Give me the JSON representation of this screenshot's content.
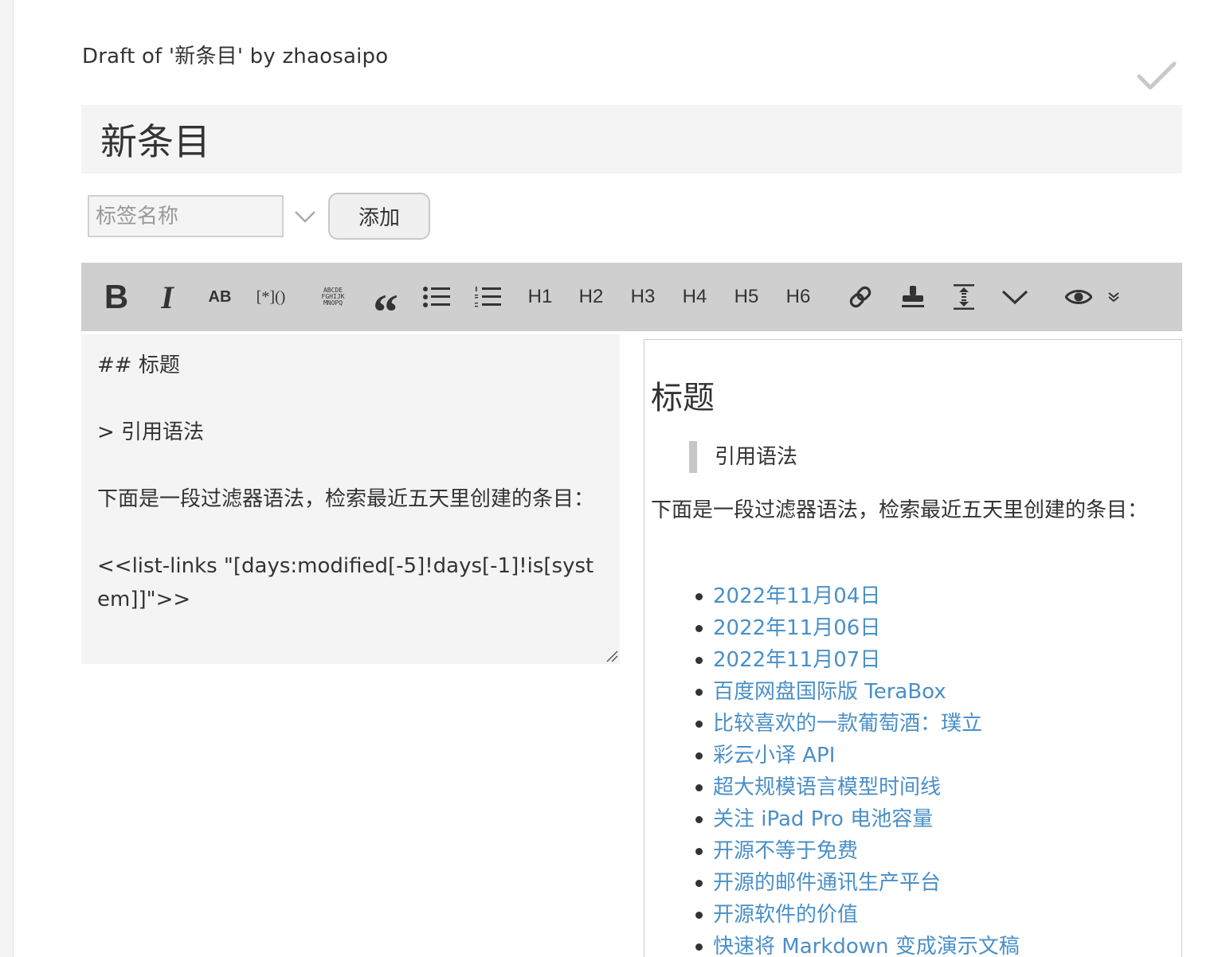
{
  "header": {
    "draft_title": "Draft of '新条目' by zhaosaipo"
  },
  "title_field": {
    "value": "新条目"
  },
  "tag_bar": {
    "placeholder": "标签名称",
    "add_label": "添加"
  },
  "toolbar": {
    "buttons": [
      {
        "name": "bold-button",
        "label": "B"
      },
      {
        "name": "italic-button",
        "label": "I"
      },
      {
        "name": "strikethrough-button",
        "label": "AB"
      },
      {
        "name": "transclude-button",
        "label": "[*]()"
      },
      {
        "name": "monospace-button",
        "label": "ABCDE FGHIJK MNOPQ"
      },
      {
        "name": "quote-button",
        "label": "“"
      },
      {
        "name": "h1-button",
        "label": "H1"
      },
      {
        "name": "h2-button",
        "label": "H2"
      },
      {
        "name": "h3-button",
        "label": "H3"
      },
      {
        "name": "h4-button",
        "label": "H4"
      },
      {
        "name": "h5-button",
        "label": "H5"
      },
      {
        "name": "h6-button",
        "label": "H6"
      }
    ],
    "icons": [
      "bullet-list-icon",
      "numbered-list-icon",
      "link-icon",
      "stamp-icon",
      "excise-icon",
      "more-dropdown-icon",
      "preview-eye-icon",
      "preview-type-dropdown-icon"
    ]
  },
  "editor": {
    "lines": [
      "## 标题",
      "",
      "> 引用语法",
      "",
      "下面是一段过滤器语法，检索最近五天里创建的条目：",
      "",
      "<<list-links \"[days:modified[-5]!days[-1]!is[system]]\">>"
    ]
  },
  "preview": {
    "heading": "标题",
    "quote": "引用语法",
    "paragraph": "下面是一段过滤器语法，检索最近五天里创建的条目：",
    "links": [
      "2022年11月04日",
      "2022年11月06日",
      "2022年11月07日",
      "百度网盘国际版 TeraBox",
      "比较喜欢的一款葡萄酒：璞立",
      "彩云小译 API",
      "超大规模语言模型时间线",
      "关注 iPad Pro 电池容量",
      "开源不等于免费",
      "开源的邮件通讯生产平台",
      "开源软件的价值",
      "快速将 Markdown 变成演示文稿"
    ]
  },
  "colors": {
    "link": "#4a8fc7",
    "toolbar_bg": "#cfcfcf",
    "field_bg": "#f4f4f4"
  }
}
